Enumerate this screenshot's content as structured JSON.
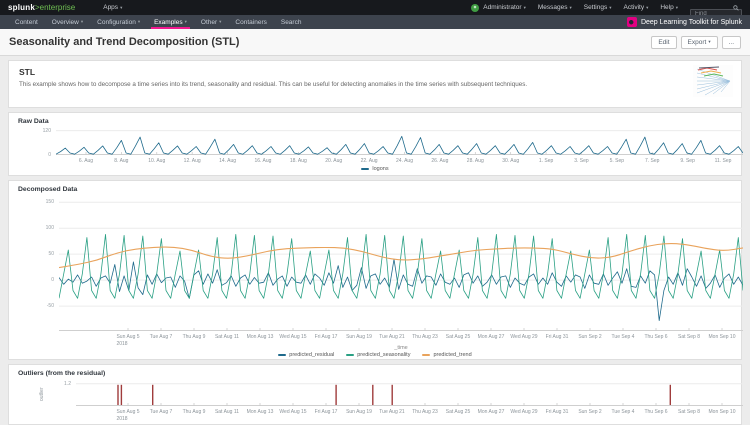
{
  "topbar": {
    "logo_main": "splunk",
    "logo_sub": ">enterprise",
    "apps_label": "Apps",
    "user_menu": [
      {
        "label": "Administrator",
        "caret": true
      },
      {
        "label": "Messages",
        "caret": true
      },
      {
        "label": "Settings",
        "caret": true
      },
      {
        "label": "Activity",
        "caret": true
      },
      {
        "label": "Help",
        "caret": true
      }
    ],
    "find_placeholder": "Find"
  },
  "navbar": {
    "items": [
      {
        "label": "Content",
        "caret": false,
        "active": false
      },
      {
        "label": "Overview",
        "caret": true,
        "active": false
      },
      {
        "label": "Configuration",
        "caret": true,
        "active": false
      },
      {
        "label": "Examples",
        "caret": true,
        "active": true
      },
      {
        "label": "Other",
        "caret": true,
        "active": false
      },
      {
        "label": "Containers",
        "caret": false,
        "active": false
      },
      {
        "label": "Search",
        "caret": false,
        "active": false
      }
    ],
    "app_name": "Deep Learning Toolkit for Splunk"
  },
  "page": {
    "title": "Seasonality and Trend Decomposition (STL)",
    "actions": {
      "edit": "Edit",
      "export": "Export",
      "more": "..."
    }
  },
  "intro": {
    "heading": "STL",
    "description": "This example shows how to decompose a time series into its trend, seasonality and residual. This can be useful for detecting anomalies in the time series with subsequent techniques."
  },
  "icons": {
    "caret": "▾",
    "search": "search-magnifier",
    "more": "..."
  },
  "colors": {
    "splunk_green": "#6fbf53",
    "accent_pink": "#f2188f",
    "residual_blue": "#1f6a8c",
    "seasonality_teal": "#2aa084",
    "trend_orange": "#e9a35c",
    "outlier_red": "#a03c3c"
  },
  "chart_data": [
    {
      "type": "line",
      "title": "Raw Data",
      "ylim": [
        0,
        128
      ],
      "yticks": [
        120,
        0
      ],
      "xticks": [
        "6. Aug",
        "8. Aug",
        "10. Aug",
        "12. Aug",
        "14. Aug",
        "16. Aug",
        "18. Aug",
        "20. Aug",
        "22. Aug",
        "24. Aug",
        "26. Aug",
        "28. Aug",
        "30. Aug",
        "1. Sep",
        "3. Sep",
        "5. Sep",
        "7. Sep",
        "9. Sep",
        "11. Sep"
      ],
      "show_legend": true,
      "series": [
        {
          "name": "logons",
          "color": "#1f6a8c",
          "values": [
            4,
            17,
            34,
            10,
            4,
            19,
            38,
            10,
            4,
            23,
            45,
            10,
            4,
            36,
            72,
            10,
            4,
            44,
            88,
            10,
            4,
            30,
            60,
            10,
            4,
            23,
            45,
            10,
            4,
            21,
            42,
            10,
            4,
            39,
            78,
            10,
            4,
            26,
            52,
            10,
            4,
            23,
            46,
            10,
            4,
            21,
            42,
            10,
            4,
            23,
            46,
            10,
            4,
            20,
            40,
            10,
            4,
            18,
            36,
            10,
            4,
            26,
            52,
            10,
            4,
            28,
            56,
            10,
            4,
            21,
            42,
            10,
            4,
            46,
            92,
            10,
            4,
            43,
            86,
            10,
            4,
            26,
            52,
            10,
            4,
            23,
            46,
            10,
            4,
            28,
            56,
            10,
            4,
            23,
            46,
            10,
            4,
            26,
            52,
            10,
            4,
            31,
            62,
            10,
            4,
            23,
            46,
            10,
            4,
            21,
            42,
            10,
            4,
            23,
            46,
            10,
            4,
            21,
            42,
            10,
            4,
            39,
            78,
            10,
            4,
            44,
            88,
            10,
            4,
            30,
            60,
            10,
            4,
            28,
            56,
            10,
            4,
            36,
            72,
            10,
            4,
            23,
            46,
            10,
            4,
            21,
            42,
            10
          ]
        }
      ]
    },
    {
      "type": "line",
      "title": "Decomposed Data",
      "xlabel": "_time",
      "ylim": [
        -98,
        160
      ],
      "yticks": [
        150,
        100,
        50,
        0,
        -50
      ],
      "xticks": [
        "Sun Aug 5",
        "Tue Aug 7",
        "Thu Aug 9",
        "Sat Aug 11",
        "Mon Aug 13",
        "Wed Aug 15",
        "Fri Aug 17",
        "Sun Aug 19",
        "Tue Aug 21",
        "Thu Aug 23",
        "Sat Aug 25",
        "Mon Aug 27",
        "Wed Aug 29",
        "Fri Aug 31",
        "Sun Sep 2",
        "Tue Sep 4",
        "Thu Sep 6",
        "Sat Sep 8",
        "Mon Sep 10"
      ],
      "xticks_year": "2018",
      "show_legend": true,
      "series": [
        {
          "name": "predicted_residual",
          "color": "#1f6a8c",
          "values": [
            5,
            -8,
            2,
            -4,
            10,
            -6,
            -2,
            6,
            -12,
            4,
            8,
            -6,
            30,
            -22,
            8,
            -20,
            35,
            -15,
            -28,
            10,
            -8,
            12,
            -5,
            4,
            6,
            -14,
            8,
            -2,
            -35,
            10,
            18,
            -8,
            12,
            -6,
            20,
            -10,
            -5,
            8,
            -12,
            4,
            10,
            -8,
            5,
            -6,
            -4,
            14,
            -10,
            2,
            8,
            -12,
            6,
            -4,
            -6,
            10,
            -8,
            12,
            4,
            -10,
            14,
            -6,
            28,
            -14,
            6,
            -20,
            -10,
            24,
            -16,
            8,
            12,
            -8,
            4,
            -14,
            40,
            -18,
            10,
            -8,
            -12,
            22,
            -6,
            8,
            6,
            -10,
            12,
            -4,
            -8,
            4,
            -14,
            10,
            14,
            -6,
            8,
            -12,
            -4,
            10,
            -8,
            6,
            8,
            -14,
            4,
            -6,
            -10,
            6,
            12,
            -8,
            4,
            -8,
            14,
            -4,
            -12,
            8,
            -4,
            10,
            6,
            -16,
            10,
            -6,
            -8,
            12,
            -10,
            4,
            16,
            -6,
            22,
            -12,
            -14,
            8,
            -6,
            18,
            10,
            -78,
            -20,
            6,
            -8,
            14,
            -10,
            22,
            6,
            -12,
            8,
            -16,
            -6,
            10,
            -14,
            4,
            12,
            -8,
            6,
            -10
          ]
        },
        {
          "name": "predicted_seasonality",
          "color": "#2aa084",
          "values": [
            -35,
            12,
            58,
            -20,
            -35,
            12,
            82,
            -20,
            -35,
            12,
            88,
            -20,
            -35,
            12,
            86,
            -20,
            -35,
            12,
            85,
            -20,
            -35,
            12,
            80,
            -20,
            -35,
            12,
            56,
            -20,
            -35,
            12,
            58,
            -20,
            -35,
            12,
            82,
            -20,
            -35,
            12,
            88,
            -20,
            -35,
            12,
            86,
            -20,
            -35,
            12,
            85,
            -20,
            -35,
            12,
            80,
            -20,
            -35,
            12,
            56,
            -20,
            -35,
            12,
            58,
            -20,
            -35,
            12,
            82,
            -20,
            -35,
            12,
            88,
            -20,
            -35,
            12,
            86,
            -20,
            -35,
            12,
            85,
            -20,
            -35,
            12,
            80,
            -20,
            -35,
            12,
            56,
            -20,
            -35,
            12,
            58,
            -20,
            -35,
            12,
            82,
            -20,
            -35,
            12,
            88,
            -20,
            -35,
            12,
            86,
            -20,
            -35,
            12,
            85,
            -20,
            -35,
            12,
            80,
            -20,
            -35,
            12,
            56,
            -20,
            -35,
            12,
            58,
            -20,
            -35,
            12,
            82,
            -20,
            -35,
            12,
            88,
            -20,
            -35,
            12,
            86,
            -20,
            -35,
            12,
            85,
            -20,
            -35,
            12,
            80,
            -20,
            -35,
            12,
            56,
            -20,
            -35,
            12,
            58,
            -20,
            -35,
            12,
            82,
            -20
          ]
        },
        {
          "name": "predicted_trend",
          "color": "#e9a35c",
          "smooth": true,
          "width": 1.1,
          "values": [
            24,
            30,
            38,
            52,
            60,
            63,
            64,
            58,
            45,
            41,
            47,
            56,
            61,
            62,
            63,
            62,
            55,
            44,
            38,
            40,
            46,
            52,
            58,
            60,
            62,
            62,
            60,
            50,
            42,
            43,
            55,
            66,
            71,
            69,
            61,
            56,
            62
          ]
        }
      ]
    },
    {
      "type": "bar",
      "title": "Outliers (from the residual)",
      "ylabel": "outlier",
      "ylim": [
        0,
        1.3
      ],
      "yticks": [
        1.2
      ],
      "xticks": [
        "Sun Aug 5",
        "Tue Aug 7",
        "Thu Aug 9",
        "Sat Aug 11",
        "Mon Aug 13",
        "Wed Aug 15",
        "Fri Aug 17",
        "Sun Aug 19",
        "Tue Aug 21",
        "Thu Aug 23",
        "Sat Aug 25",
        "Mon Aug 27",
        "Wed Aug 29",
        "Fri Aug 31",
        "Sun Sep 2",
        "Tue Sep 4",
        "Thu Sep 6",
        "Sat Sep 8",
        "Mon Sep 10"
      ],
      "xticks_year": "2018",
      "bars": {
        "color": "#a03c3c",
        "value": 1.15,
        "positions": [
          0.063,
          0.068,
          0.115,
          0.39,
          0.445,
          0.474,
          0.891
        ],
        "dates_approx": [
          "Aug 7",
          "Aug 7",
          "Aug 9",
          "Aug 19",
          "Aug 21",
          "Aug 22",
          "Sep 6"
        ]
      }
    }
  ]
}
